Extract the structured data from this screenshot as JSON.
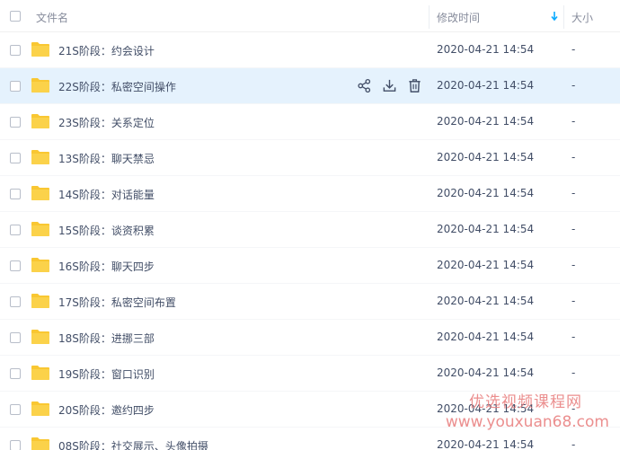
{
  "header": {
    "name_label": "文件名",
    "time_label": "修改时间",
    "size_label": "大小"
  },
  "colors": {
    "accent": "#09aaff",
    "folder": "#f9c732",
    "hover_row": "#e5f2fd",
    "watermark": "#e98282"
  },
  "icons": {
    "share": "share-icon",
    "download": "download-icon",
    "delete": "trash-icon",
    "folder": "folder-icon",
    "sort": "sort-desc-arrow-icon"
  },
  "files": [
    {
      "name": "21S阶段：约会设计",
      "time": "2020-04-21 14:54",
      "size": "-"
    },
    {
      "name": "22S阶段：私密空间操作",
      "time": "2020-04-21 14:54",
      "size": "-"
    },
    {
      "name": "23S阶段：关系定位",
      "time": "2020-04-21 14:54",
      "size": "-"
    },
    {
      "name": "13S阶段：聊天禁忌",
      "time": "2020-04-21 14:54",
      "size": "-"
    },
    {
      "name": "14S阶段：对话能量",
      "time": "2020-04-21 14:54",
      "size": "-"
    },
    {
      "name": "15S阶段：谈资积累",
      "time": "2020-04-21 14:54",
      "size": "-"
    },
    {
      "name": "16S阶段：聊天四步",
      "time": "2020-04-21 14:54",
      "size": "-"
    },
    {
      "name": "17S阶段：私密空间布置",
      "time": "2020-04-21 14:54",
      "size": "-"
    },
    {
      "name": "18S阶段：进挪三部",
      "time": "2020-04-21 14:54",
      "size": "-"
    },
    {
      "name": "19S阶段：窗口识别",
      "time": "2020-04-21 14:54",
      "size": "-"
    },
    {
      "name": "20S阶段：邀约四步",
      "time": "2020-04-21 14:54",
      "size": "-"
    },
    {
      "name": "08S阶段：社交展示、头像拍摄",
      "time": "2020-04-21 14:54",
      "size": "-"
    }
  ],
  "watermark": {
    "title": "优选视频课程网",
    "url": "www.youxuan68.com"
  }
}
